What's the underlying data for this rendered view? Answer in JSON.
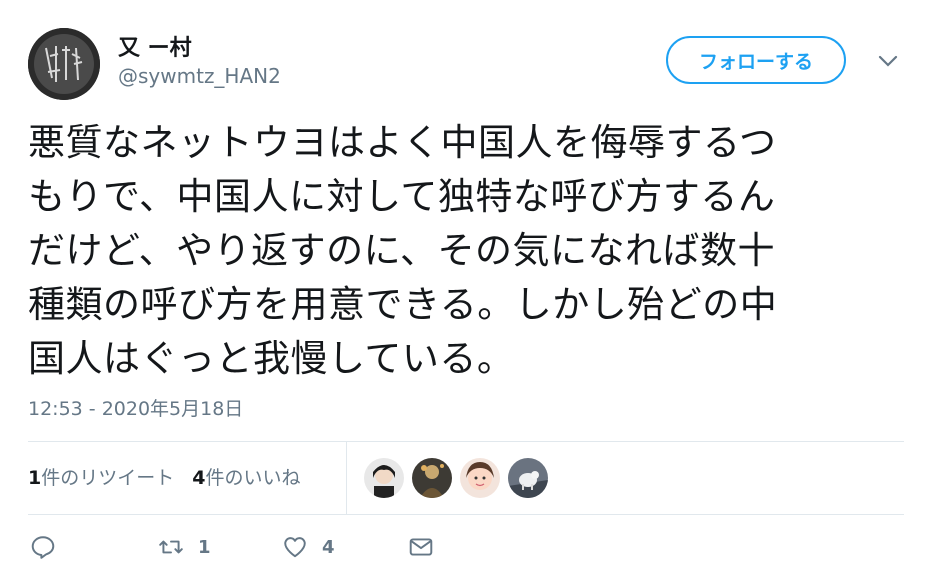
{
  "user": {
    "display_name": "又 ー村",
    "handle": "@sywmtz_HAN2"
  },
  "header": {
    "follow_label": "フォローする",
    "caret_icon": "chevron-down-icon"
  },
  "tweet": {
    "lines": [
      "悪質なネットウヨはよく中国人を侮辱するつ",
      "もりで、中国人に対して独特な呼び方するん",
      "だけど、やり返すのに、その気になれば数十",
      "種類の呼び方を用意できる。しかし殆どの中",
      "国人はぐっと我慢している。"
    ],
    "timestamp": "12:53 - 2020年5月18日"
  },
  "stats": {
    "retweets_count": "1",
    "retweets_label": "件のリツイート",
    "likes_count": "4",
    "likes_label": "件のいいね"
  },
  "actions": {
    "reply_icon": "reply-icon",
    "retweet_icon": "retweet-icon",
    "retweet_count": "1",
    "like_icon": "heart-icon",
    "like_count": "4",
    "dm_icon": "envelope-icon"
  },
  "colors": {
    "accent": "#1da1f2",
    "muted": "#657786",
    "text": "#14171a",
    "divider": "#e1e8ed"
  }
}
